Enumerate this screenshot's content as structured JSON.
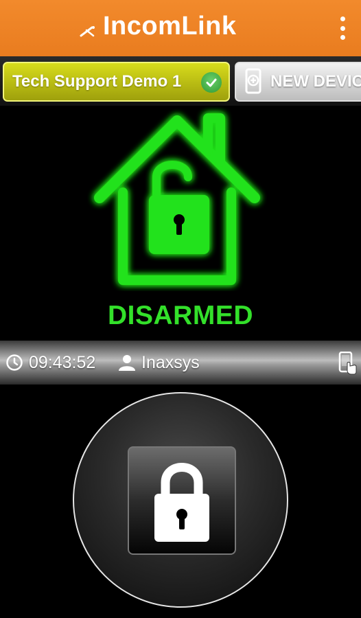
{
  "app": {
    "brand": "IncomLink",
    "brand_color": "#F0842A"
  },
  "tabs": {
    "active_device": "Tech Support Demo 1",
    "new_device_label": "NEW DEVICE"
  },
  "status": {
    "label": "DISARMED",
    "color": "#33E02A"
  },
  "info": {
    "time": "09:43:52",
    "user": "Inaxsys"
  },
  "icons": {
    "menu": "more-vert-icon",
    "check": "check-circle-icon",
    "new_device": "add-device-icon",
    "clock": "clock-icon",
    "user": "user-icon",
    "device": "phone-touch-icon",
    "house": "house-unlocked-icon",
    "lock": "padlock-icon"
  }
}
